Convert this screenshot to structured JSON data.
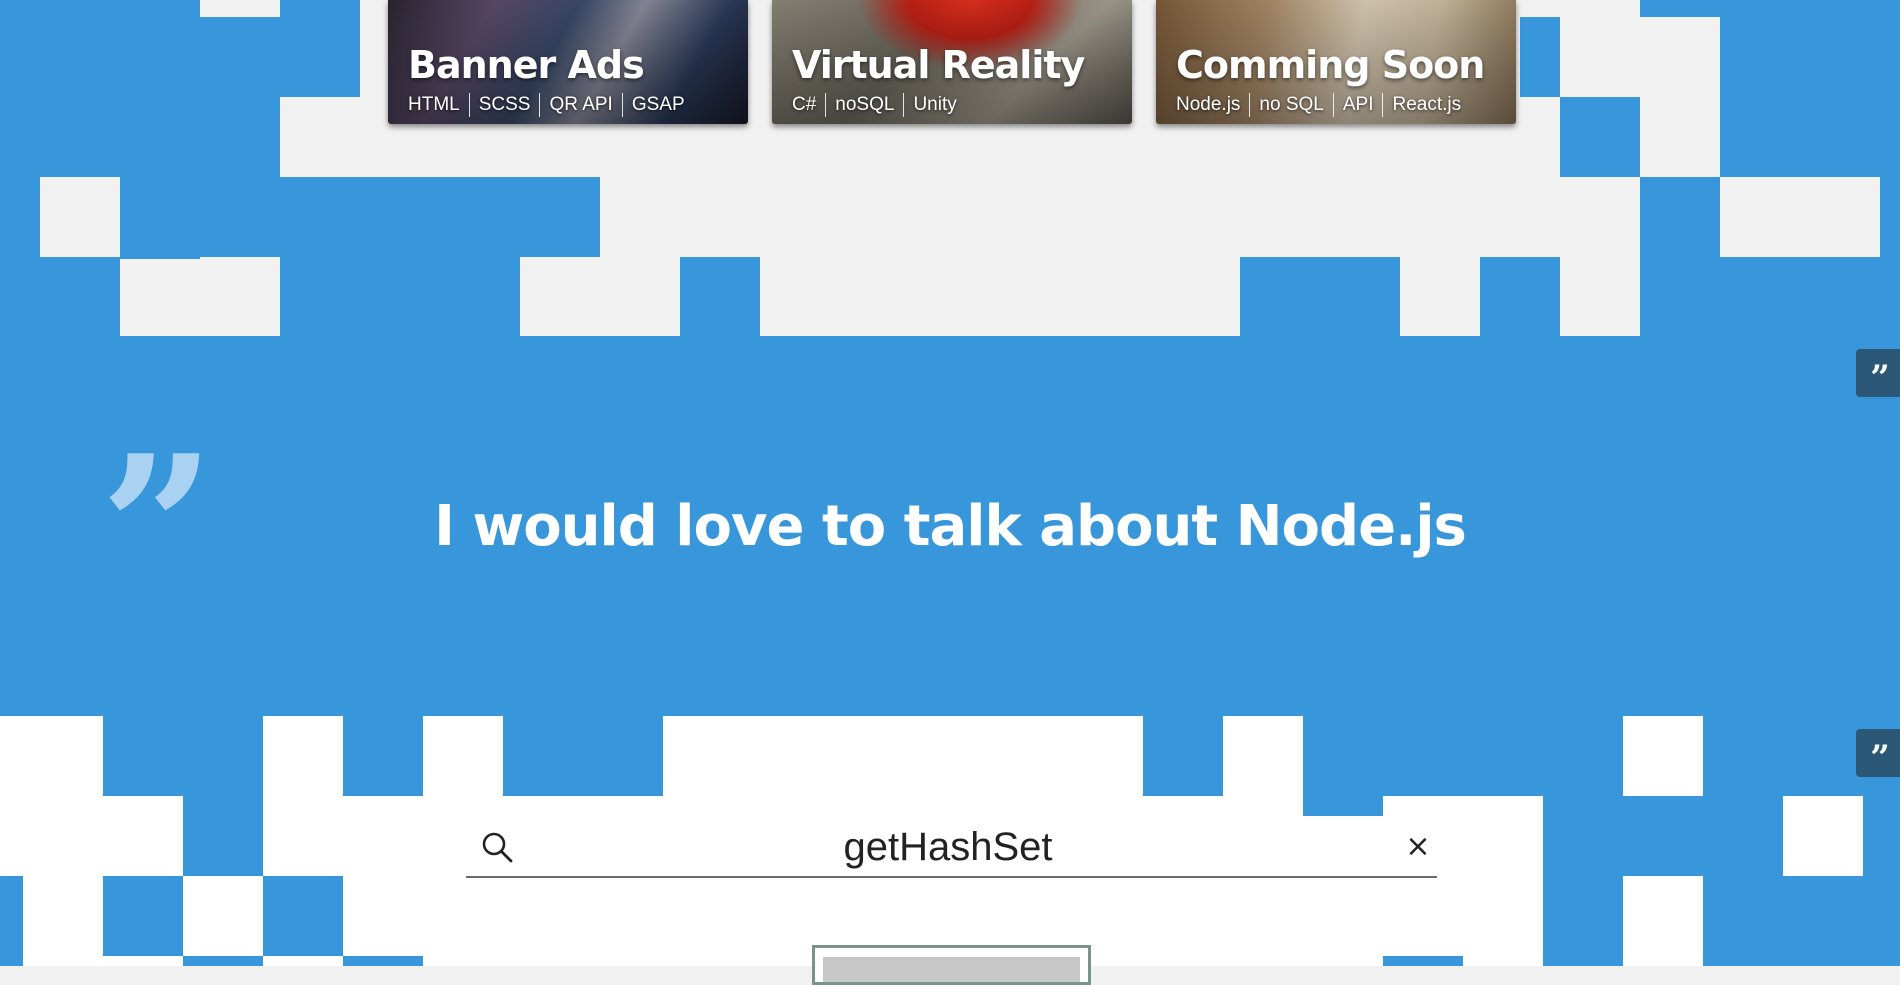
{
  "projects": [
    {
      "title": "Banner Ads",
      "tags": [
        "HTML",
        "SCSS",
        "QR API",
        "GSAP"
      ]
    },
    {
      "title": "Virtual Reality",
      "tags": [
        "C#",
        "noSQL",
        "Unity"
      ]
    },
    {
      "title": "Comming Soon",
      "tags": [
        "Node.js",
        "no SQL",
        "API",
        "React.js"
      ]
    }
  ],
  "quote": {
    "mark": "”",
    "text": "I would love to talk about Node.js"
  },
  "side_buttons": [
    {
      "icon": "quote-icon",
      "glyph": "”"
    },
    {
      "icon": "quote-icon",
      "glyph": "”"
    }
  ],
  "search": {
    "value": "getHashSet",
    "clear_glyph": "×"
  },
  "colors": {
    "accent": "#3896da",
    "light_accent": "#a9d2f2",
    "dark_button": "#2c5878",
    "background": "#f1f1f1"
  }
}
